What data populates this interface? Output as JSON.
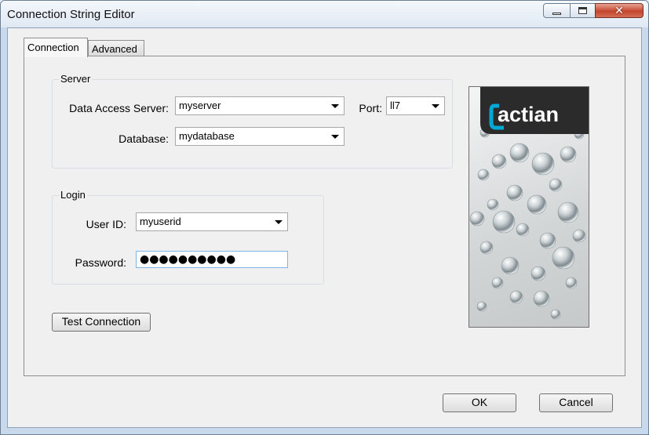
{
  "window": {
    "title": "Connection String Editor",
    "controls": {
      "minimize": "minimize-icon",
      "maximize": "maximize-icon",
      "close": "close-icon"
    }
  },
  "tabs": [
    {
      "label": "Connection",
      "selected": true
    },
    {
      "label": "Advanced",
      "selected": false
    }
  ],
  "server": {
    "group_label": "Server",
    "data_access_server_label": "Data Access Server:",
    "data_access_server_value": "myserver",
    "port_label": "Port:",
    "port_value": "ll7",
    "database_label": "Database:",
    "database_value": "mydatabase"
  },
  "login": {
    "group_label": "Login",
    "user_id_label": "User ID:",
    "user_id_value": "myuserid",
    "password_label": "Password:",
    "password_value": "●●●●●●●●●●"
  },
  "buttons": {
    "test_connection": "Test Connection",
    "ok": "OK",
    "cancel": "Cancel"
  },
  "logo": {
    "text": "actian",
    "icon": "water-drops-image"
  },
  "colors": {
    "logo_band": "#2b2b2b",
    "logo_accent": "#00a8d6",
    "close_button": "#c4452c"
  }
}
